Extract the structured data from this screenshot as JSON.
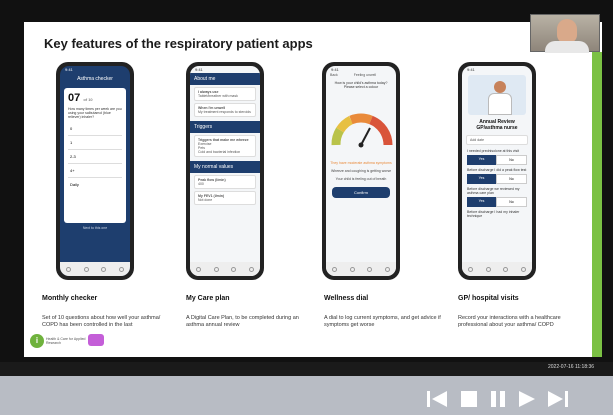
{
  "slide": {
    "title": "Key features of the respiratory patient apps",
    "features": [
      {
        "name": "Monthly checker",
        "description": "Set of 10 questions about how well your asthma/ COPD has been controlled in the last"
      },
      {
        "name": "My Care plan",
        "description": "A Digital Care Plan, to be completed during an asthma annual review"
      },
      {
        "name": "Wellness dial",
        "description": "A dial to log current symptoms, and get advice if symptoms get worse"
      },
      {
        "name": "GP/ hospital visits",
        "description": "Record your interactions with a healthcare professional about your asthma/ COPD"
      }
    ],
    "phone1": {
      "header": "Asthma checker",
      "number": "07",
      "of": "of 10",
      "question": "How many times per week are you using your salbutamol (blue reliever) inhaler?",
      "options": [
        "0",
        "1",
        "2-3",
        "4+",
        "Daily"
      ],
      "next": "Next to this one"
    },
    "phone2": {
      "section1": "About me",
      "field1_label": "I always use",
      "field1_value": "Tablet/breather with mask",
      "field2_label": "When I'm unwell",
      "field2_value": "My treatment responds to steroids",
      "section2": "Triggers",
      "triggers_label": "Triggers that make me wheeze",
      "triggers": [
        "Exercise",
        "Pets",
        "Cold and bacterial infection"
      ],
      "section3": "My normal values",
      "v1_label": "Peak flow (l/min)",
      "v1_value": "400",
      "v2_label": "My FEV1 (l/min)",
      "v2_value": "Not done"
    },
    "phone3": {
      "back": "Back",
      "title": "Feeling unwell",
      "question": "How is your child's asthma today? Please select a colour",
      "alert": "They have moderate asthma symptoms",
      "line1": "Wheeze and coughing is getting worse",
      "line2": "Your child is feeling out of breath",
      "button": "Confirm"
    },
    "phone4": {
      "title": "Annual Review GP/asthma nurse",
      "date": "Add date",
      "q1": "I needed prednisolone at this visit",
      "yes": "Yes",
      "no": "No",
      "q2": "Before discharge I did a peak flow test",
      "q3": "Before discharge we reviewed my asthma care plan",
      "q4": "Before discharge I had my inhaler technique"
    }
  },
  "branding": {
    "logo_letter": "i",
    "logo_text": "Health & Care for Applied Research"
  },
  "video": {
    "timestamp": "2022-07-16 11:18:36"
  },
  "colors": {
    "navy": "#1e3e6e",
    "green": "#7bc144",
    "dial_red": "#d9543a",
    "controls_bg": "#b8bcc4"
  }
}
